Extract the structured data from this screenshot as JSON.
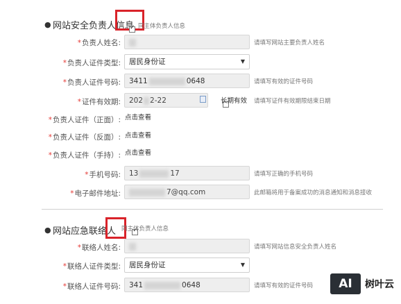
{
  "section1": {
    "title": "网站安全负责人信息",
    "same_as_label": "同主体负责人信息",
    "fields": {
      "name": {
        "label": "负责人姓名:",
        "value": "",
        "hint": "请填写网站主要负责人姓名"
      },
      "id_type": {
        "label": "负责人证件类型:",
        "value": "居民身份证"
      },
      "id_number": {
        "label": "负责人证件号码:",
        "value_prefix": "3411",
        "value_suffix": "0648",
        "hint": "请填写有效的证件号码"
      },
      "validity": {
        "label": "证件有效期:",
        "value_prefix": "202",
        "value_suffix": "2-22",
        "long_term_label": "长期有效",
        "hint": "请填写证件有效期限结束日期"
      },
      "id_front": {
        "label": "负责人证件（正面）:",
        "link": "点击查看"
      },
      "id_back": {
        "label": "负责人证件（反面）:",
        "link": "点击查看"
      },
      "id_hand": {
        "label": "负责人证件（手持）:",
        "link": "点击查看"
      },
      "phone": {
        "label": "手机号码:",
        "value_prefix": "13",
        "value_suffix": "17",
        "hint": "请填写正确的手机号码"
      },
      "email": {
        "label": "电子邮件地址:",
        "value_suffix": "7@qq.com",
        "hint": "此邮箱将用于备案成功的消息通知和消息接收"
      }
    }
  },
  "section2": {
    "title": "网站应急联络人",
    "same_as_label": "同主体负责人信息",
    "fields": {
      "name": {
        "label": "联络人姓名:",
        "value": "",
        "hint": "请填写网站信息安全负责人姓名"
      },
      "id_type": {
        "label": "联络人证件类型:",
        "value": "居民身份证"
      },
      "id_number": {
        "label": "联络人证件号码:",
        "value_prefix": "341",
        "value_suffix": "0648",
        "hint": "请填写有效的证件号码"
      }
    }
  },
  "watermark": {
    "logo_text": "AI",
    "brand": "树叶云"
  },
  "colors": {
    "highlight_red": "#d9232a",
    "required_red": "#e53935",
    "watermark_dark": "#2a2f35"
  }
}
